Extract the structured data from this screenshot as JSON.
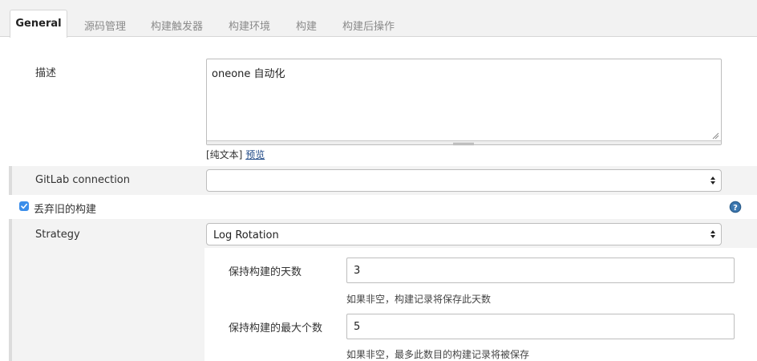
{
  "tabs": [
    {
      "label": "General",
      "active": true
    },
    {
      "label": "源码管理",
      "active": false
    },
    {
      "label": "构建触发器",
      "active": false
    },
    {
      "label": "构建环境",
      "active": false
    },
    {
      "label": "构建",
      "active": false
    },
    {
      "label": "构建后操作",
      "active": false
    }
  ],
  "description": {
    "label": "描述",
    "value": "oneone 自动化",
    "plain_text_label": "[纯文本]",
    "preview_link": "预览"
  },
  "gitlab": {
    "label": "GitLab connection",
    "selected": ""
  },
  "discard_old_builds": {
    "label": "丢弃旧的构建",
    "checked": true,
    "help_icon": "help-icon"
  },
  "strategy": {
    "label": "Strategy",
    "selected": "Log Rotation"
  },
  "days_to_keep": {
    "label": "保持构建的天数",
    "value": "3",
    "hint": "如果非空，构建记录将保存此天数"
  },
  "num_to_keep": {
    "label": "保持构建的最大个数",
    "value": "5",
    "hint": "如果非空，最多此数目的构建记录将被保存"
  },
  "colors": {
    "tab_bar_bg": "#f2f2f2",
    "row_bg": "#f3f3f3",
    "checkbox": "#3b8eea",
    "help_icon": "#2a5d8c",
    "link": "#204a87"
  }
}
